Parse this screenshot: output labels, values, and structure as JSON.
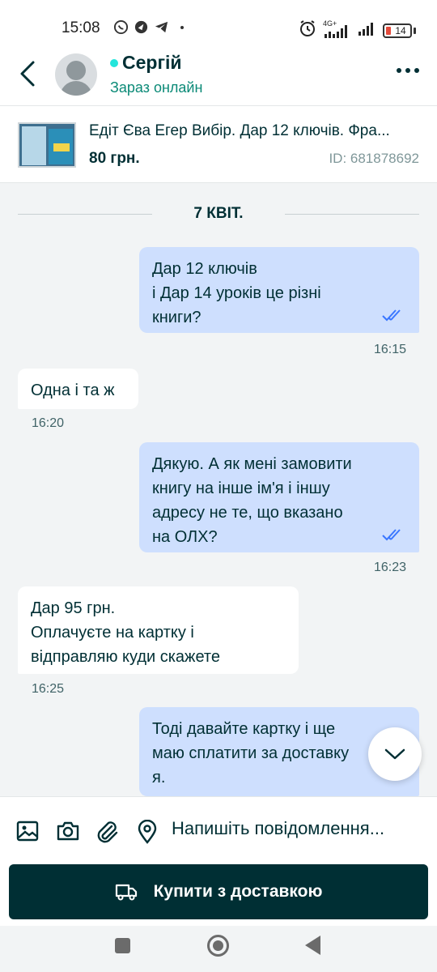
{
  "status_bar": {
    "time": "15:08",
    "network": "4G+",
    "battery": "14"
  },
  "header": {
    "back_icon": "chevron-left-icon",
    "contact_name": "Сергій",
    "contact_status": "Зараз онлайн",
    "more_icon": "more-horizontal-icon",
    "online_color": "#23e5db"
  },
  "listing": {
    "title": "Едіт Єва Егер Вибір. Дар 12 ключів. Фра...",
    "price": "80 грн.",
    "id_label": "ID: 681878692"
  },
  "chat": {
    "date_separator": "7 КВІТ.",
    "messages": [
      {
        "direction": "out",
        "lines": [
          "Дар 12 ключів",
          "і Дар 14 уроків це різні",
          "книги?"
        ],
        "time": "16:15",
        "read": true
      },
      {
        "direction": "in",
        "lines": [
          "Одна і та ж"
        ],
        "time": "16:20"
      },
      {
        "direction": "out",
        "lines": [
          "Дякую. А як мені замовити",
          "книгу на інше ім'я і іншу",
          "адресу не те, що вказано",
          "на ОЛХ?"
        ],
        "time": "16:23",
        "read": true
      },
      {
        "direction": "in",
        "lines": [
          "Дар 95 грн.",
          "Оплачуєте на картку і",
          "відправляю куди скажете"
        ],
        "time": "16:25"
      },
      {
        "direction": "out",
        "lines": [
          "Тоді давайте картку і ще",
          "маю сплатити за доставку",
          "я."
        ]
      }
    ]
  },
  "composer": {
    "placeholder": "Напишіть повідомлення...",
    "icons": [
      "image-icon",
      "camera-icon",
      "paperclip-icon",
      "location-pin-icon"
    ]
  },
  "buy_button": {
    "label": "Купити з доставкою",
    "icon": "delivery-truck-icon",
    "bg_color": "#002f34"
  },
  "colors": {
    "outgoing_bubble": "#cedffe",
    "incoming_bubble": "#ffffff",
    "text": "#002f34"
  }
}
